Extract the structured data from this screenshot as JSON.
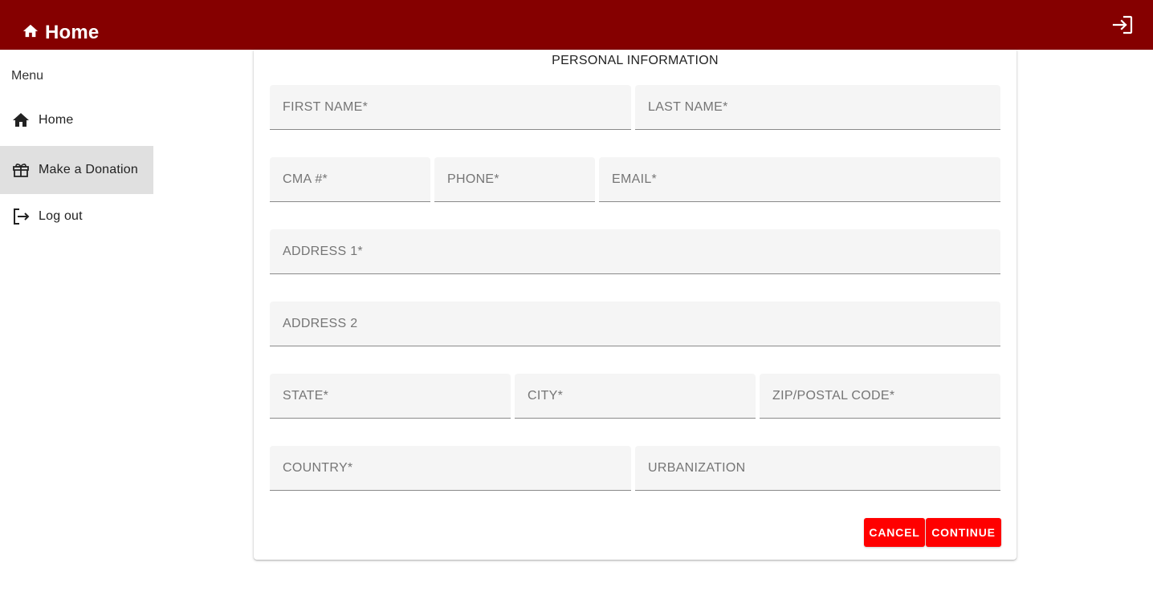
{
  "header": {
    "title": "Home",
    "home_icon": "home-icon",
    "login_icon": "login-icon",
    "background_color": "#850000"
  },
  "sidebar": {
    "menu_label": "Menu",
    "items": [
      {
        "label": "Home",
        "icon": "home-icon",
        "active": false
      },
      {
        "label": "Make a Donation",
        "icon": "gift-icon",
        "active": true
      },
      {
        "label": "Log out",
        "icon": "logout-icon",
        "active": false
      }
    ]
  },
  "form": {
    "title": "PERSONAL INFORMATION",
    "fields": {
      "first_name": {
        "placeholder": "FIRST NAME*",
        "value": ""
      },
      "last_name": {
        "placeholder": "LAST NAME*",
        "value": ""
      },
      "cma": {
        "placeholder": "CMA #*",
        "value": ""
      },
      "phone": {
        "placeholder": "PHONE*",
        "value": ""
      },
      "email": {
        "placeholder": "EMAIL*",
        "value": ""
      },
      "address1": {
        "placeholder": "ADDRESS 1*",
        "value": ""
      },
      "address2": {
        "placeholder": "ADDRESS 2",
        "value": ""
      },
      "state": {
        "placeholder": "STATE*",
        "value": ""
      },
      "city": {
        "placeholder": "CITY*",
        "value": ""
      },
      "zip": {
        "placeholder": "ZIP/POSTAL CODE*",
        "value": ""
      },
      "country": {
        "placeholder": "COUNTRY*",
        "value": ""
      },
      "urbanization": {
        "placeholder": "URBANIZATION",
        "value": ""
      }
    },
    "buttons": {
      "cancel_label": "CANCEL",
      "continue_label": "CONTINUE",
      "button_color": "#ff0000"
    }
  }
}
